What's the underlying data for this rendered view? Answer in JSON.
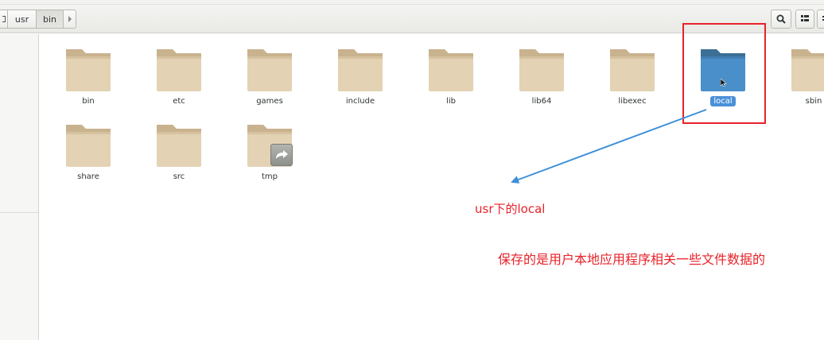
{
  "toolbar": {
    "path": [
      {
        "label": "",
        "icon": "home-icon"
      },
      {
        "label": "usr"
      },
      {
        "label": "bin"
      }
    ],
    "next_icon": "chevron-right-icon",
    "search_icon": "search-icon",
    "view_icon": "list-view-icon",
    "menu_icon": "menu-icon"
  },
  "items": [
    {
      "name": "bin"
    },
    {
      "name": "etc"
    },
    {
      "name": "games"
    },
    {
      "name": "include"
    },
    {
      "name": "lib"
    },
    {
      "name": "lib64"
    },
    {
      "name": "libexec"
    },
    {
      "name": "local",
      "selected": true
    },
    {
      "name": "sbin"
    },
    {
      "name": "share"
    },
    {
      "name": "src"
    },
    {
      "name": "tmp",
      "emblem": "symlink-icon"
    }
  ],
  "annotations": {
    "title": "usr下的local",
    "description": "保存的是用户本地应用程序相关一些文件数据的",
    "color": "#e8222a",
    "arrow_color": "#3d8fd9"
  },
  "colors": {
    "folder": "#dcc9a8",
    "folder_tab": "#c9b28e",
    "folder_selected": "#4a8fc9",
    "selection_label": "#4a90d9"
  }
}
